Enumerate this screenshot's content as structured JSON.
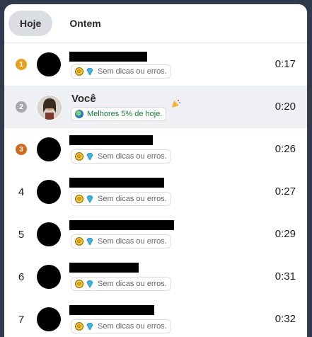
{
  "tabs": [
    {
      "label": "Hoje",
      "active": true
    },
    {
      "label": "Ontem",
      "active": false
    }
  ],
  "rows": [
    {
      "rank": "1",
      "medal": "gold",
      "badge": "Sem dicas ou erros.",
      "time": "0:17",
      "me": false
    },
    {
      "rank": "2",
      "medal": "silver",
      "name": "Você",
      "badge": "Melhores 5% de hoje.",
      "time": "0:20",
      "me": true
    },
    {
      "rank": "3",
      "medal": "bronze",
      "badge": "Sem dicas ou erros.",
      "time": "0:26",
      "me": false
    },
    {
      "rank": "4",
      "badge": "Sem dicas ou erros.",
      "time": "0:27",
      "me": false
    },
    {
      "rank": "5",
      "badge": "Sem dicas ou erros.",
      "time": "0:29",
      "me": false
    },
    {
      "rank": "6",
      "badge": "Sem dicas ou erros.",
      "time": "0:31",
      "me": false
    },
    {
      "rank": "7",
      "badge": "Sem dicas ou erros.",
      "time": "0:32",
      "me": false
    }
  ],
  "icons": {
    "medal": "medal-icon",
    "smile": "smile-icon",
    "gem": "gem-icon",
    "globe": "globe-icon",
    "flag": "party-flag-icon"
  },
  "colors": {
    "gold": "#e4a21f",
    "silver": "#a7a9ad",
    "bronze": "#cf6a1e",
    "highlight_text": "#197a3a"
  }
}
